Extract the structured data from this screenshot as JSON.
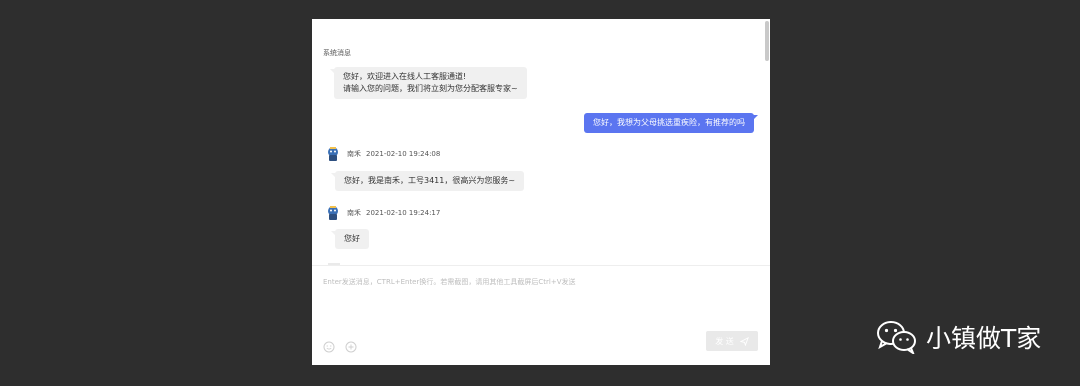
{
  "chat": {
    "system_label": "系统消息",
    "welcome_line1": "您好，欢迎进入在线人工客服通道!",
    "welcome_line2": "请输入您的问题，我们将立刻为您分配客服专家~",
    "user_message": "您好，我想为父母挑选重疾险，有推荐的吗",
    "agent_name": "南禾",
    "agent_msg1_time": "2021-02-10 19:24:08",
    "agent_msg1": "您好，我是南禾，工号3411，很高兴为您服务~",
    "agent_msg2_time": "2021-02-10 19:24:17",
    "agent_msg2": "您好"
  },
  "composer": {
    "placeholder": "Enter发送消息，CTRL+Enter换行。若需截图，请用其他工具截屏后Ctrl+V发送",
    "send_label": "发 送",
    "emoji_icon": "smile-icon",
    "screenshot_icon": "scissors-icon",
    "send_icon": "paper-plane-icon"
  },
  "watermark": {
    "text": "小镇做T家",
    "icon": "wechat-icon"
  },
  "colors": {
    "user_bubble": "#5b75f0",
    "agent_bubble": "#f0f0f0",
    "backdrop": "#2e2e2e"
  }
}
